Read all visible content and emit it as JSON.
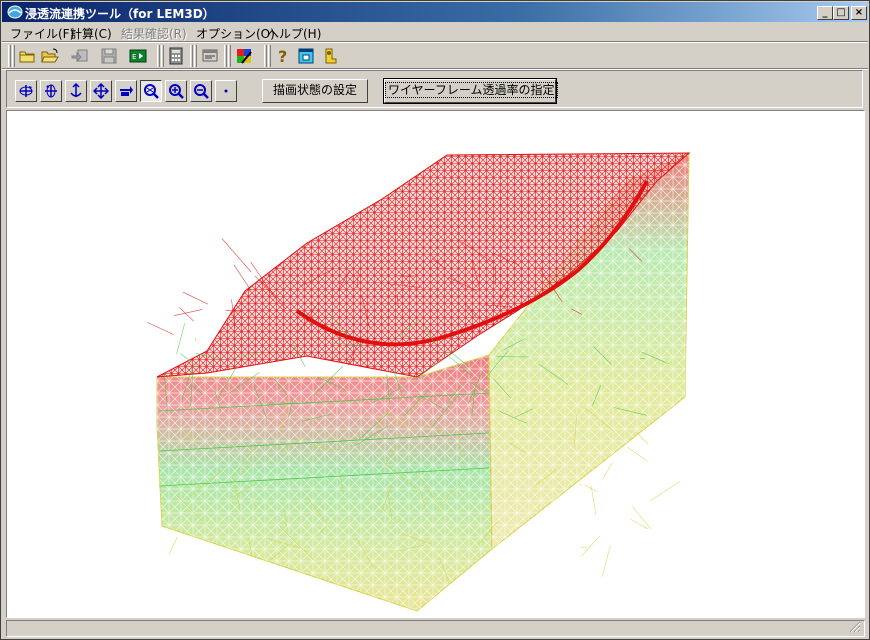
{
  "window": {
    "title": "浸透流連携ツール（for LEM3D）"
  },
  "caption_buttons": {
    "minimize": "_",
    "maximize": "□",
    "close": "×"
  },
  "menu": [
    {
      "label": "ファイル(F)",
      "disabled": false
    },
    {
      "label": "計算(C)",
      "disabled": false
    },
    {
      "label": "結果確認(R)",
      "disabled": true
    },
    {
      "label": "オプション(O)",
      "disabled": false
    },
    {
      "label": "ヘルプ(H)",
      "disabled": false
    }
  ],
  "toolbar_icons": [
    "new-file-icon",
    "open-folder-icon",
    "import-icon",
    "save-icon",
    "run-icon",
    "calculator-icon",
    "form-icon",
    "palette-icon",
    "help-icon",
    "window-icon",
    "export-icon"
  ],
  "view_tools": [
    "rotate-x-icon",
    "rotate-y-icon",
    "rotate-z-icon",
    "pan-icon",
    "move-icon",
    "zoom-window-icon",
    "zoom-in-icon",
    "zoom-out-icon",
    "point-icon"
  ],
  "buttons": {
    "draw_settings": "描画状態の設定",
    "wireframe_transparency": "ワイヤーフレーム透過率の指定"
  },
  "colors": {
    "title_start": "#0a246a",
    "wire_red": "#e01010",
    "wire_green": "#40c840",
    "wire_yellow": "#d8d040"
  }
}
